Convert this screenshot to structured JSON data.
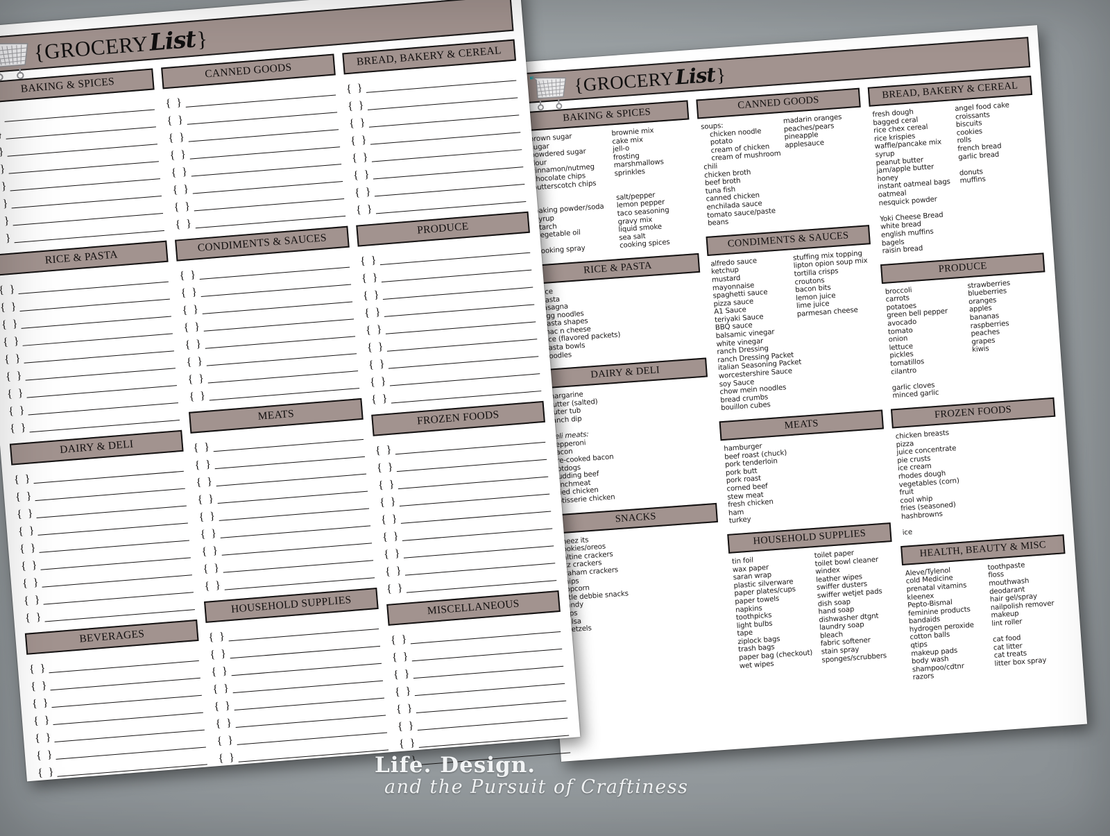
{
  "watermark": {
    "line1": "Life. Design.",
    "line2": "and the Pursuit of Craftiness"
  },
  "blank_sheet": {
    "title_prefix": "{GROCERY",
    "title_script": "List",
    "title_suffix": "}",
    "cart_icon": "shopping-cart-icon",
    "columns": [
      {
        "categories": [
          {
            "label": "BAKING & SPICES",
            "lines": 8
          },
          {
            "label": "RICE & PASTA",
            "lines": 9
          },
          {
            "label": "DAIRY & DELI",
            "lines": 9
          },
          {
            "label": "BEVERAGES",
            "lines": 7
          }
        ]
      },
      {
        "categories": [
          {
            "label": "CANNED GOODS",
            "lines": 8
          },
          {
            "label": "CONDIMENTS & SAUCES",
            "lines": 8
          },
          {
            "label": "MEATS",
            "lines": 9
          },
          {
            "label": "HOUSEHOLD SUPPLIES",
            "lines": 8
          }
        ]
      },
      {
        "categories": [
          {
            "label": "BREAD, BAKERY & CEREAL",
            "lines": 8
          },
          {
            "label": "PRODUCE",
            "lines": 9
          },
          {
            "label": "FROZEN FOODS",
            "lines": 9
          },
          {
            "label": "MISCELLANEOUS",
            "lines": 8
          }
        ]
      }
    ]
  },
  "filled_sheet": {
    "title_prefix": "{GROCERY",
    "title_script": "List",
    "title_suffix": "}",
    "cart_icon": "shopping-cart-icon",
    "columns": [
      {
        "categories": [
          {
            "label": "BAKING & SPICES",
            "left_items": [
              "brown sugar",
              "sugar",
              "powdered sugar",
              "flour",
              "cinnamon/nutmeg",
              "chocolate chips",
              "butterscotch chips",
              "",
              "",
              "baking powder/soda",
              "syrup",
              "starch",
              "vegetable oil",
              "",
              "cooking spray"
            ],
            "right_items": [
              "brownie mix",
              "cake mix",
              "jell-o",
              "frosting",
              "marshmallows",
              "sprinkles",
              "",
              "",
              "salt/pepper",
              "lemon pepper",
              "taco seasoning",
              "gravy mix",
              "liquid smoke",
              "sea salt",
              "cooking spices"
            ]
          },
          {
            "label": "RICE & PASTA",
            "left_items": [
              "rice",
              "pasta",
              "lasagna",
              "egg noodles",
              "pasta shapes",
              "mac n cheese",
              "rice (flavored packets)",
              "pasta bowls",
              "noodles"
            ],
            "right_items": []
          },
          {
            "label": "DAIRY & DELI",
            "left_items": [
              "margarine",
              "butter (salted)",
              "buter tub",
              "ranch dip",
              "",
              "deli meats:",
              "pepperoni",
              "bacon",
              "pre-cooked bacon",
              "hotdogs",
              "budding beef",
              "lunchmeat",
              "fried chicken",
              "rotisserie chicken"
            ],
            "right_items": []
          },
          {
            "label": "SNACKS",
            "left_items": [
              "cheez its",
              "cookies/oreos",
              "saltine crackers",
              "ritz crackers",
              "graham crackers",
              "chips",
              "popcorn",
              "little debbie snacks",
              "candy",
              "dips",
              "salsa",
              "pretzels"
            ],
            "right_items": []
          }
        ]
      },
      {
        "categories": [
          {
            "label": "CANNED GOODS",
            "left_items": [
              "soups:",
              "  chicken noodle",
              "  potato",
              "  cream of chicken",
              "  cream of mushroom",
              "chili",
              "chicken broth",
              "beef broth",
              "tuna fish",
              "canned chicken",
              "enchilada sauce",
              "tomato sauce/paste",
              "beans"
            ],
            "right_items": [
              "madarin oranges",
              "peaches/pears",
              "pineapple",
              "applesauce"
            ]
          },
          {
            "label": "CONDIMENTS & SAUCES",
            "left_items": [
              "alfredo sauce",
              "ketchup",
              "mustard",
              "mayonnaise",
              "spaghetti sauce",
              "pizza sauce",
              "A1 Sauce",
              "teriyaki Sauce",
              "BBQ sauce",
              "balsamic vinegar",
              "white vinegar",
              "ranch Dressing",
              "ranch Dressing Packet",
              "italian Seasoning Packet",
              "worcestershire Sauce",
              "soy Sauce",
              "chow mein noodles",
              "bread crumbs",
              "bouillon cubes"
            ],
            "right_items": [
              "stuffing mix topping",
              "lipton opion soup mix",
              "tortilla crisps",
              "croutons",
              "bacon bits",
              "lemon juice",
              "lime juice",
              "parmesan cheese"
            ]
          },
          {
            "label": "MEATS",
            "left_items": [
              "hamburger",
              "beef roast (chuck)",
              "pork tenderloin",
              "pork butt",
              "pork roast",
              "corned beef",
              "stew meat",
              "fresh chicken",
              "ham",
              "turkey"
            ],
            "right_items": []
          },
          {
            "label": "HOUSEHOLD SUPPLIES",
            "left_items": [
              "tin foil",
              "wax paper",
              "saran wrap",
              "plastic silverware",
              "paper plates/cups",
              "paper towels",
              "napkins",
              "toothpicks",
              "light bulbs",
              "tape",
              "ziplock bags",
              "trash bags",
              "paper bag (checkout)",
              "wet wipes"
            ],
            "right_items": [
              "toilet paper",
              "toilet bowl cleaner",
              "windex",
              "leather wipes",
              "swiffer dusters",
              "swiffer wetjet pads",
              "dish soap",
              "hand soap",
              "dishwasher dtgnt",
              "laundry soap",
              "bleach",
              "fabric softener",
              "stain spray",
              "sponges/scrubbers"
            ]
          }
        ]
      },
      {
        "categories": [
          {
            "label": "BREAD, BAKERY & CEREAL",
            "left_items": [
              "fresh dough",
              "bagged ceral",
              "rice chex cereal",
              "rice krispies",
              "waffle/pancake mix",
              "syrup",
              "peanut butter",
              "jam/apple butter",
              "honey",
              "instant oatmeal bags",
              "oatmeal",
              "nesquick powder",
              "",
              "Yoki Cheese Bread",
              "white bread",
              "english muffins",
              "bagels",
              "raisin bread"
            ],
            "right_items": [
              "angel food cake",
              "croissants",
              "biscuits",
              "cookies",
              "rolls",
              "french bread",
              "garlic bread",
              "",
              "donuts",
              "muffins"
            ]
          },
          {
            "label": "PRODUCE",
            "left_items": [
              "broccoli",
              "carrots",
              "potatoes",
              "green bell pepper",
              "avocado",
              "tomato",
              "onion",
              "lettuce",
              "pickles",
              "tomatillos",
              "cilantro",
              "",
              "garlic cloves",
              "minced garlic"
            ],
            "right_items": [
              "strawberries",
              "blueberries",
              "oranges",
              "apples",
              "bananas",
              "raspberries",
              "peaches",
              "grapes",
              "kiwis"
            ]
          },
          {
            "label": "FROZEN FOODS",
            "left_items": [
              "chicken breasts",
              "pizza",
              "juice concentrate",
              "pie crusts",
              "ice cream",
              "rhodes dough",
              "vegetables (corn)",
              "fruit",
              "cool whip",
              "fries (seasoned)",
              "hashbrowns",
              "",
              "ice"
            ],
            "right_items": []
          },
          {
            "label": "HEALTH, BEAUTY & MISC",
            "left_items": [
              "Aleve/Tylenol",
              "cold Medicine",
              "prenatal vitamins",
              "kleenex",
              "Pepto-Bismal",
              "feminine products",
              "bandaids",
              "hydrogen peroxide",
              "cotton balls",
              "qtips",
              "makeup pads",
              "body wash",
              "shampoo/cdtnr",
              "razors"
            ],
            "right_items": [
              "toothpaste",
              "floss",
              "mouthwash",
              "deodarant",
              "hair gel/spray",
              "nailpolish remover",
              "makeup",
              "lint roller",
              "",
              "cat food",
              "cat litter",
              "cat treats",
              "litter box spray"
            ]
          }
        ]
      }
    ]
  },
  "colors": {
    "header_fill": "#a2938f",
    "ink": "#141212",
    "paper": "#ffffff",
    "background": "#9aa0a3"
  }
}
